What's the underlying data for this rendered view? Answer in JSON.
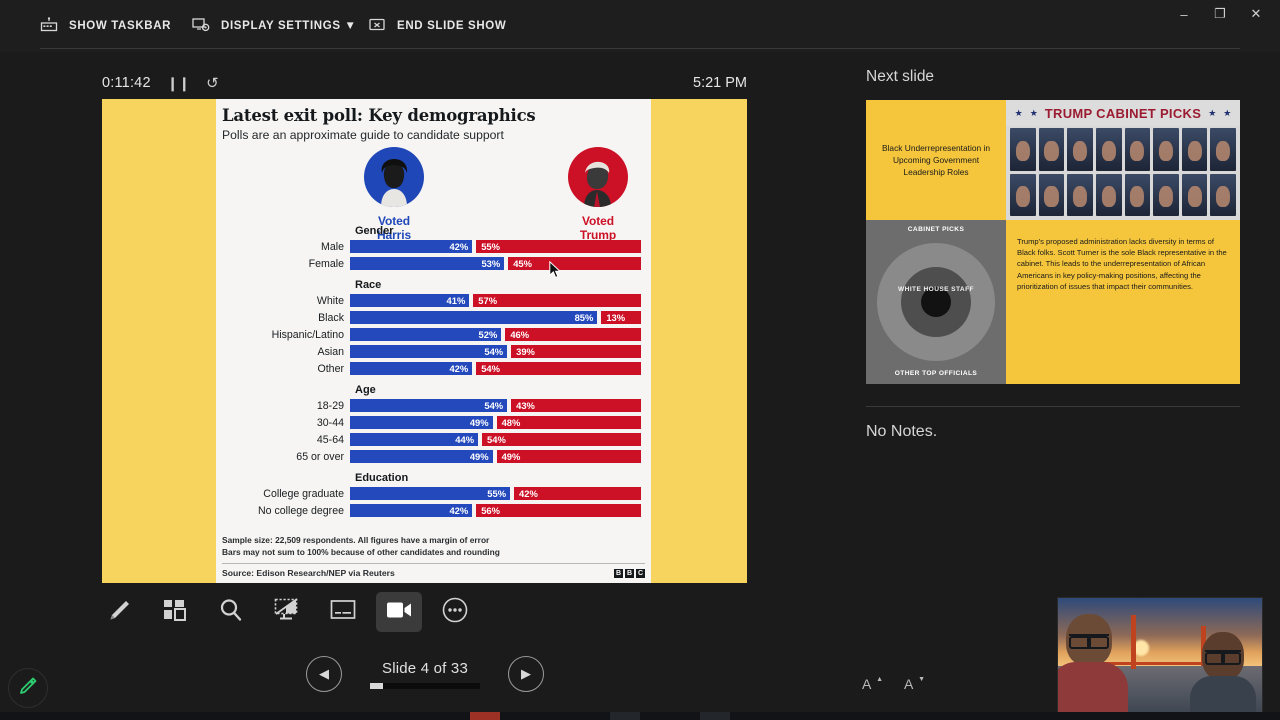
{
  "window": {
    "minimize_label": "–",
    "restore_label": "❐",
    "close_label": "✕"
  },
  "topbar": {
    "show_taskbar": "SHOW TASKBAR",
    "display_settings": "DISPLAY SETTINGS ▼",
    "end_slide_show": "END SLIDE SHOW"
  },
  "timer": {
    "elapsed": "0:11:42",
    "pause_icon": "❙❙",
    "reset_icon": "↺",
    "clock": "5:21 PM"
  },
  "slide": {
    "title": "Latest exit poll: Key demographics",
    "subtitle": "Polls are an approximate guide to candidate support",
    "harris_label": "Voted Harris",
    "trump_label": "Voted Trump",
    "footnote_line1": "Sample size: 22,509 respondents. All figures have a margin of error",
    "footnote_line2": "Bars may not sum to 100% because of other candidates and rounding",
    "source": "Source: Edison Research/NEP via Reuters",
    "logo_letters": [
      "B",
      "B",
      "C"
    ],
    "colors": {
      "harris_blue": "#2449bc",
      "trump_red": "#cc1127",
      "slide_yellow": "#f7d45e",
      "slide_paper": "#f6f5f3"
    }
  },
  "chart_data": {
    "type": "bar",
    "title": "Latest exit poll: Key demographics",
    "subtitle": "Polls are an approximate guide to candidate support",
    "orientation": "horizontal",
    "stacked_pair": true,
    "unit": "%",
    "xlim": [
      0,
      100
    ],
    "grid": false,
    "legend_position": "top",
    "series": [
      {
        "name": "Voted Harris",
        "color": "#2449bc"
      },
      {
        "name": "Voted Trump",
        "color": "#cc1127"
      }
    ],
    "groups": [
      {
        "name": "Gender",
        "rows": [
          {
            "label": "Male",
            "harris": 42,
            "trump": 55,
            "harris_text": "42%",
            "trump_text": "55%"
          },
          {
            "label": "Female",
            "harris": 53,
            "trump": 45,
            "harris_text": "53%",
            "trump_text": "45%"
          }
        ]
      },
      {
        "name": "Race",
        "rows": [
          {
            "label": "White",
            "harris": 41,
            "trump": 57,
            "harris_text": "41%",
            "trump_text": "57%"
          },
          {
            "label": "Black",
            "harris": 85,
            "trump": 13,
            "harris_text": "85%",
            "trump_text": "13%"
          },
          {
            "label": "Hispanic/Latino",
            "harris": 52,
            "trump": 46,
            "harris_text": "52%",
            "trump_text": "46%"
          },
          {
            "label": "Asian",
            "harris": 54,
            "trump": 39,
            "harris_text": "54%",
            "trump_text": "39%"
          },
          {
            "label": "Other",
            "harris": 42,
            "trump": 54,
            "harris_text": "42%",
            "trump_text": "54%"
          }
        ]
      },
      {
        "name": "Age",
        "rows": [
          {
            "label": "18-29",
            "harris": 54,
            "trump": 43,
            "harris_text": "54%",
            "trump_text": "43%"
          },
          {
            "label": "30-44",
            "harris": 49,
            "trump": 48,
            "harris_text": "49%",
            "trump_text": "48%"
          },
          {
            "label": "45-64",
            "harris": 44,
            "trump": 54,
            "harris_text": "44%",
            "trump_text": "54%"
          },
          {
            "label": "65 or over",
            "harris": 49,
            "trump": 49,
            "harris_text": "49%",
            "trump_text": "49%"
          }
        ]
      },
      {
        "name": "Education",
        "rows": [
          {
            "label": "College graduate",
            "harris": 55,
            "trump": 42,
            "harris_text": "55%",
            "trump_text": "42%"
          },
          {
            "label": "No college degree",
            "harris": 42,
            "trump": 56,
            "harris_text": "42%",
            "trump_text": "56%"
          }
        ]
      }
    ],
    "footnote": "Sample size: 22,509 respondents. All figures have a margin of error. Bars may not sum to 100% because of other candidates and rounding",
    "source": "Source: Edison Research/NEP via Reuters"
  },
  "toolbar": {
    "items": [
      {
        "icon": "pen-icon",
        "name": "pen-tool"
      },
      {
        "icon": "grid-icon",
        "name": "all-slides-tool"
      },
      {
        "icon": "magnifier-icon",
        "name": "zoom-tool"
      },
      {
        "icon": "blank-screen-icon",
        "name": "black-screen-tool"
      },
      {
        "icon": "captions-icon",
        "name": "subtitles-tool"
      },
      {
        "icon": "camera-icon",
        "name": "camera-tool",
        "active": true
      },
      {
        "icon": "more-icon",
        "name": "more-options-tool"
      }
    ]
  },
  "navigation": {
    "previous_label": "◀",
    "next_label": "▶",
    "slide_counter": "Slide 4 of 33",
    "current_slide": 4,
    "total_slides": 33,
    "progress_percent": 12
  },
  "pen_indicator": {
    "icon": "pen-icon",
    "color": "#2ecc71"
  },
  "right_panel": {
    "next_slide_title": "Next slide",
    "notes_text": "No Notes.",
    "increase_font_label": "A",
    "decrease_font_label": "A",
    "thumbnail": {
      "headline": "Black Underrepresentation in Upcoming Government Leadership Roles",
      "cabinet_title": "TRUMP CABINET PICKS",
      "star": "★",
      "wheel_top_caption": "CABINET PICKS",
      "wheel_mid_caption": "WHITE HOUSE STAFF",
      "wheel_bottom_caption": "OTHER TOP OFFICIALS",
      "body_text": "Trump's proposed administration lacks diversity in terms of Black folks. Scott Turner is the sole Black representative in the cabinet. This leads to the underrepresentation of African Americans in key policy-making positions, affecting the prioritization of issues that impact their communities."
    }
  }
}
